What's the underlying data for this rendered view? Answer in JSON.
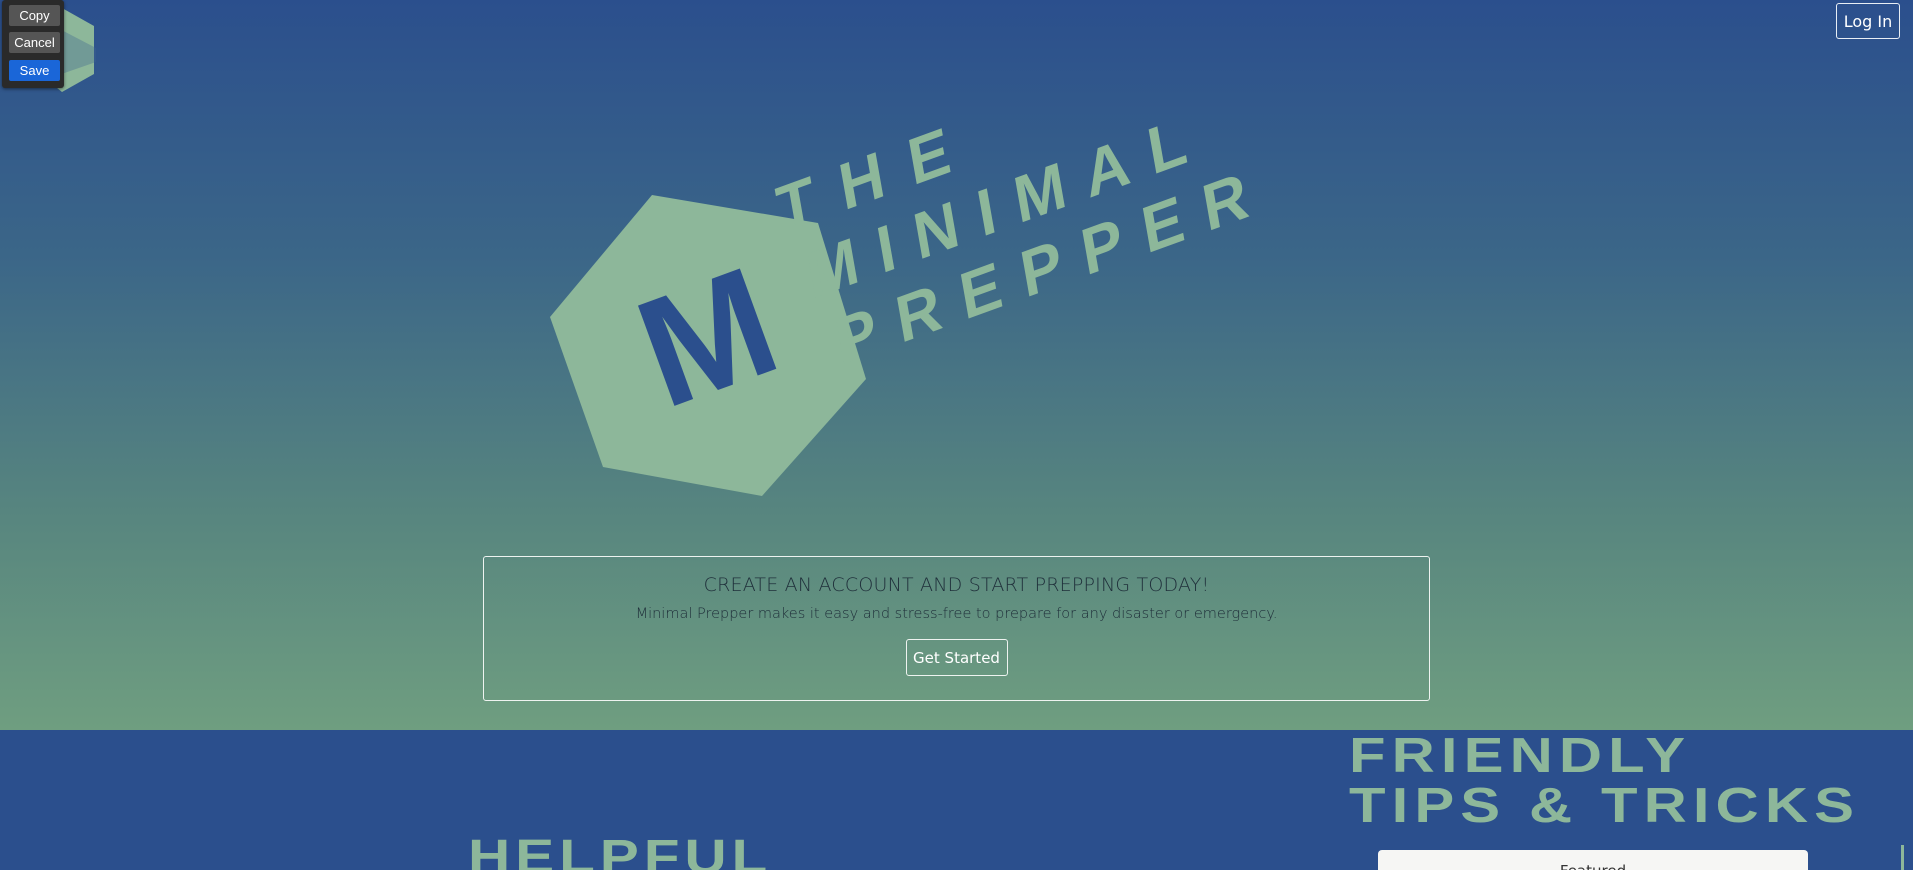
{
  "popup": {
    "copy_label": "Copy",
    "cancel_label": "Cancel",
    "save_label": "Save"
  },
  "header": {
    "login_label": "Log In"
  },
  "logo": {
    "letter": "M",
    "line1": "THE",
    "line2": "MINIMAL",
    "line3": "PREPPER"
  },
  "cta": {
    "title": "CREATE AN ACCOUNT AND START PREPPING TODAY!",
    "subtitle": "Minimal Prepper makes it easy and stress-free to prepare for any disaster or emergency.",
    "button_label": "Get Started"
  },
  "features": {
    "tips_line1": "FRIENDLY",
    "tips_line2": "TIPS & TRICKS",
    "helpful": "HELPFUL",
    "featured_label": "Featured"
  },
  "colors": {
    "brand_blue": "#2b4f8d",
    "brand_green": "#8db79a",
    "save_blue": "#1a66d8"
  }
}
